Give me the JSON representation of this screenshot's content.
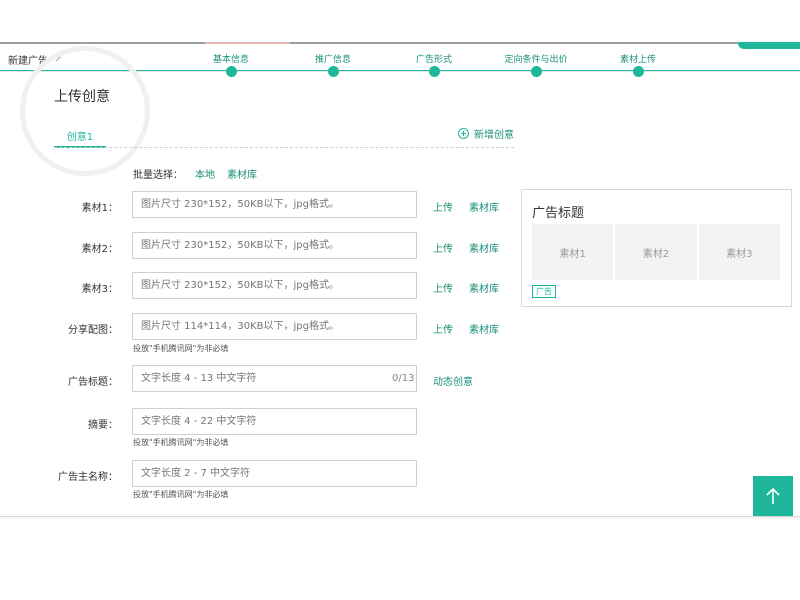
{
  "header": {
    "new_ad_label": "新建广告"
  },
  "steps": [
    {
      "label": "基本信息"
    },
    {
      "label": "推广信息"
    },
    {
      "label": "广告形式"
    },
    {
      "label": "定向条件与出价"
    },
    {
      "label": "素材上传"
    }
  ],
  "section": {
    "title": "上传创意",
    "tab_label": "创意1",
    "add_label": "新增创意"
  },
  "batch": {
    "label": "批量选择：",
    "local": "本地",
    "library": "素材库"
  },
  "form": {
    "material1": {
      "label": "素材1：",
      "placeholder": "图片尺寸 230*152，50KB以下，jpg格式。",
      "upload": "上传",
      "library": "素材库"
    },
    "material2": {
      "label": "素材2：",
      "placeholder": "图片尺寸 230*152，50KB以下，jpg格式。",
      "upload": "上传",
      "library": "素材库"
    },
    "material3": {
      "label": "素材3：",
      "placeholder": "图片尺寸 230*152，50KB以下，jpg格式。",
      "upload": "上传",
      "library": "素材库"
    },
    "share_image": {
      "label": "分享配图：",
      "placeholder": "图片尺寸 114*114，30KB以下，jpg格式。",
      "upload": "上传",
      "library": "素材库",
      "hint": "投放\"手机腾讯网\"为非必填"
    },
    "ad_title": {
      "label": "广告标题：",
      "placeholder": "文字长度 4 - 13 中文字符",
      "counter": "0/13",
      "dynamic": "动态创意"
    },
    "summary": {
      "label": "摘要：",
      "placeholder": "文字长度 4 - 22 中文字符",
      "hint": "投放\"手机腾讯网\"为非必填"
    },
    "advertiser": {
      "label": "广告主名称：",
      "placeholder": "文字长度 2 - 7 中文字符",
      "hint": "投放\"手机腾讯网\"为非必填"
    }
  },
  "preview": {
    "title": "广告标题",
    "thumbs": [
      "素材1",
      "素材2",
      "素材3"
    ],
    "tag": "广告"
  },
  "colors": {
    "accent": "#1fb79b",
    "link": "#1a8f79"
  },
  "icons": {
    "back_to_top": "arrow-up-icon",
    "add": "plus-circle-icon",
    "dropdown": "chevron-down-icon"
  }
}
